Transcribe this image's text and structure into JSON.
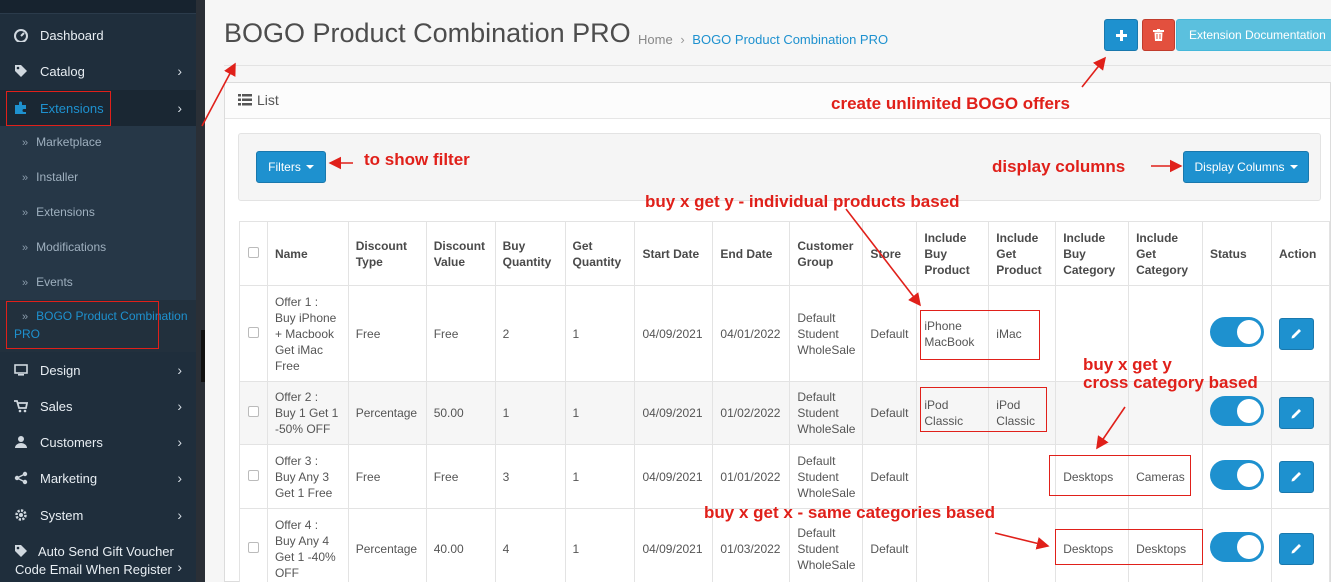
{
  "sidebar": {
    "items": [
      {
        "label": "Dashboard",
        "icon": "dashboard-icon"
      },
      {
        "label": "Catalog",
        "icon": "tag-icon"
      },
      {
        "label": "Extensions",
        "icon": "puzzle-icon"
      },
      {
        "label": "Design",
        "icon": "monitor-icon"
      },
      {
        "label": "Sales",
        "icon": "cart-icon"
      },
      {
        "label": "Customers",
        "icon": "user-icon"
      },
      {
        "label": "Marketing",
        "icon": "share-icon"
      },
      {
        "label": "System",
        "icon": "gear-icon"
      },
      {
        "label": "Auto Send Gift Voucher Code Email When Register",
        "icon": "tag-icon"
      }
    ],
    "sub_items": [
      {
        "label": "Marketplace"
      },
      {
        "label": "Installer"
      },
      {
        "label": "Extensions"
      },
      {
        "label": "Modifications"
      },
      {
        "label": "Events"
      },
      {
        "label": "BOGO Product Combination PRO"
      }
    ]
  },
  "header": {
    "title": "BOGO Product Combination PRO",
    "breadcrumb_home": "Home",
    "breadcrumb_sep": "›",
    "breadcrumb_current": "BOGO Product Combination PRO",
    "doc_button": "Extension Documentation"
  },
  "panel": {
    "title": "List",
    "filters_button": "Filters",
    "columns_button": "Display Columns"
  },
  "table": {
    "headers": [
      "Name",
      "Discount Type",
      "Discount Value",
      "Buy Quantity",
      "Get Quantity",
      "Start Date",
      "End Date",
      "Customer Group",
      "Store",
      "Include Buy Product",
      "Include Get Product",
      "Include Buy Category",
      "Include Get Category",
      "Status",
      "Action"
    ],
    "rows": [
      {
        "name": "Offer 1 : Buy iPhone + Macbook Get iMac Free",
        "type": "Free",
        "value": "Free",
        "buy_qty": "2",
        "get_qty": "1",
        "start": "04/09/2021",
        "end": "04/01/2022",
        "group": "Default Student WholeSale",
        "store": "Default",
        "buy_product": "iPhone MacBook",
        "get_product": "iMac",
        "buy_category": "",
        "get_category": ""
      },
      {
        "name": "Offer 2 : Buy 1 Get 1 -50% OFF",
        "type": "Percentage",
        "value": "50.00",
        "buy_qty": "1",
        "get_qty": "1",
        "start": "04/09/2021",
        "end": "01/02/2022",
        "group": "Default Student WholeSale",
        "store": "Default",
        "buy_product": "iPod Classic",
        "get_product": "iPod Classic",
        "buy_category": "",
        "get_category": ""
      },
      {
        "name": "Offer 3 : Buy Any 3 Get 1 Free",
        "type": "Free",
        "value": "Free",
        "buy_qty": "3",
        "get_qty": "1",
        "start": "04/09/2021",
        "end": "01/01/2022",
        "group": "Default Student WholeSale",
        "store": "Default",
        "buy_product": "",
        "get_product": "",
        "buy_category": "Desktops",
        "get_category": "Cameras"
      },
      {
        "name": "Offer 4 : Buy Any 4 Get 1 -40% OFF",
        "type": "Percentage",
        "value": "40.00",
        "buy_qty": "4",
        "get_qty": "1",
        "start": "04/09/2021",
        "end": "01/03/2022",
        "group": "Default Student WholeSale",
        "store": "Default",
        "buy_product": "",
        "get_product": "",
        "buy_category": "Desktops",
        "get_category": "Desktops"
      }
    ]
  },
  "annotations": {
    "create": "create unlimited BOGO offers",
    "filter": "to show filter",
    "columns": "display columns",
    "individual": "buy x get y - individual products based",
    "cross1": "buy x get y",
    "cross2": "cross category based",
    "same": "buy x get x - same categories based"
  },
  "colors": {
    "primary": "#1e91cf",
    "danger": "#e3503e",
    "info": "#5bc0de",
    "annotation": "#e0201a",
    "sidebar": "#1f2e3c"
  }
}
